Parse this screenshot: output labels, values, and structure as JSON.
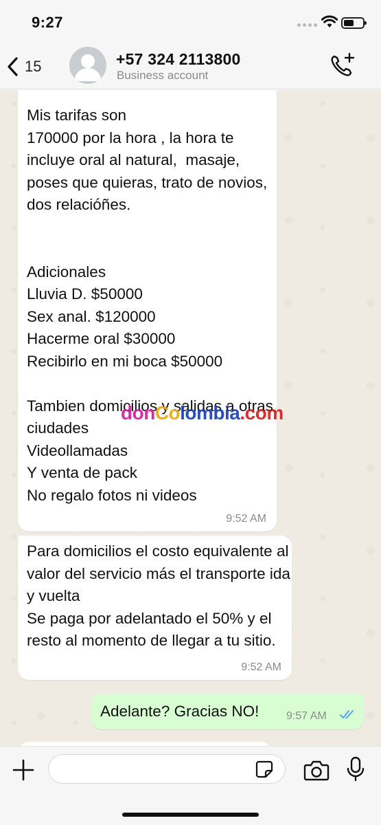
{
  "status_bar": {
    "time": "9:27"
  },
  "header": {
    "back_count": "15",
    "contact_name": "+57 324 2113800",
    "contact_subtitle": "Business account"
  },
  "messages": [
    {
      "direction": "incoming",
      "text": "Mis tarifas son\n170000 por la hora , la hora te incluye oral al natural,  masaje, poses que quieras, trato de novios, dos relacióñes.\n\n\nAdicionales\nLluvia D. $50000\nSex anal. $120000\nHacerme oral $30000\nRecibirlo en mi boca $50000\n\nTambien domicilios y salidas a otras ciudades\nVideollamadas\nY venta de pack\nNo regalo fotos ni videos",
      "time": "9:52 AM"
    },
    {
      "direction": "incoming",
      "text": "Para domicilios el costo equivalente al valor del servicio más el transporte ida y vuelta\nSe paga por adelantado el 50% y el resto al momento de llegar a tu sitio.",
      "time": "9:52 AM"
    },
    {
      "direction": "outgoing",
      "text": "Adelante? Gracias NO!",
      "time": "9:57 AM",
      "status": "read"
    }
  ],
  "watermark": {
    "part1": "don",
    "part2": "Co",
    "part3": "lombia",
    "part4": ".com"
  },
  "colors": {
    "outgoing_bubble": "#d9fdd3",
    "incoming_bubble": "#ffffff",
    "read_ticks": "#53a6e8"
  }
}
